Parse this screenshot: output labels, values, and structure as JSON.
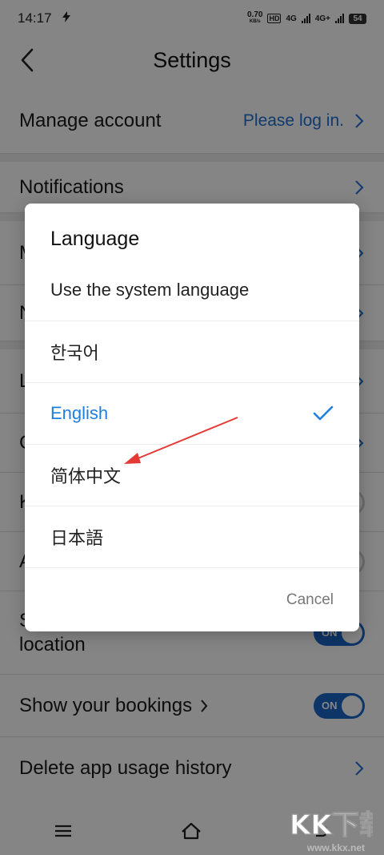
{
  "status_bar": {
    "time": "14:17",
    "net_speed_top": "0.70",
    "net_speed_unit": "KB/s",
    "hd_label": "HD",
    "sim1_label": "4G",
    "sim2_label": "4G+",
    "battery": "54"
  },
  "header": {
    "title": "Settings"
  },
  "rows": {
    "manage_account": {
      "label": "Manage account",
      "value": "Please log in."
    },
    "notifications": {
      "label": "Notifications"
    },
    "row3": {
      "label": "M"
    },
    "row4": {
      "label": "N"
    },
    "row5": {
      "label": "L"
    },
    "row6": {
      "label": "C"
    },
    "row7": {
      "label": "K"
    },
    "row8": {
      "label": "A"
    },
    "location": {
      "label_line1": "S",
      "label_line2": "location",
      "toggle": "ON"
    },
    "bookings": {
      "label": "Show your bookings",
      "toggle": "ON"
    },
    "delete_history": {
      "label": "Delete app usage history"
    }
  },
  "dialog": {
    "title": "Language",
    "options": [
      {
        "label": "Use the system language"
      },
      {
        "label": "한국어"
      },
      {
        "label": "English"
      },
      {
        "label": "简体中文"
      },
      {
        "label": "日本語"
      }
    ],
    "cancel": "Cancel"
  },
  "watermark": {
    "text": "KK下载",
    "url": "www.kkx.net"
  },
  "colors": {
    "accent": "#1f7fe0",
    "toggle_on": "#1a66c7",
    "annotation_arrow": "#e53935"
  }
}
